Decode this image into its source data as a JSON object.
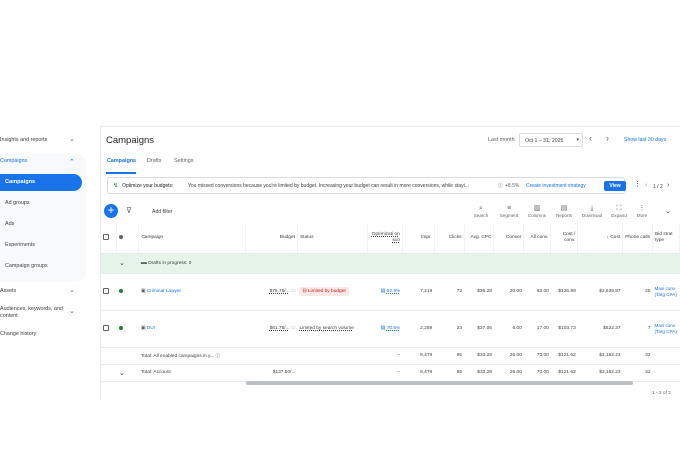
{
  "sidebar": {
    "items": [
      {
        "label": "Insights and reports",
        "chevron": "⌄"
      },
      {
        "label": "Campaigns",
        "chevron": "⌃"
      },
      {
        "label": "Campaigns"
      },
      {
        "label": "Ad groups"
      },
      {
        "label": "Ads"
      },
      {
        "label": "Experiments"
      },
      {
        "label": "Campaign groups"
      },
      {
        "label": "Assets",
        "chevron": "⌄"
      },
      {
        "label": "Audiences, keywords, and content",
        "chevron": "⌄"
      },
      {
        "label": "Change history"
      }
    ]
  },
  "header": {
    "title": "Campaigns",
    "date_label": "Last month",
    "date_range": "Oct 1 – 31, 2025",
    "show_last": "Show last 30 days"
  },
  "tabs": [
    "Campaigns",
    "Drafts",
    "Settings"
  ],
  "banner": {
    "bold": "Optimize your budgets:",
    "text": "You missed conversions because you're limited by budget. Increasing your budget can result in more conversions, while stayi...",
    "uplift": "+8.5%",
    "link": "Create investment strategy",
    "button": "View",
    "pager": "1 / 2"
  },
  "toolbar": {
    "add_filter": "Add filter",
    "buttons": [
      "Search",
      "Segment",
      "Columns",
      "Reports",
      "Download",
      "Expand",
      "More"
    ]
  },
  "table": {
    "headers": [
      "Campaign",
      "Budget",
      "Status",
      "Optimizati on sco",
      "Impr.",
      "Clicks",
      "Avg. CPC",
      "Conver",
      "All conv.",
      "Cost / conv.",
      "Cost",
      "Phone calls",
      "Bid strat type"
    ],
    "drafts_label": "Drafts in progress: 0",
    "rows": [
      {
        "name": "Criminal Lawyer",
        "budget": "$75.75/...",
        "status": "Limited by budget",
        "opt": "52.9%",
        "impr": "7,219",
        "clicks": "72",
        "cpc": "$35.28",
        "conv": "20.00",
        "allconv": "53.00",
        "costconv": "$126.99",
        "cost": "$2,539.87",
        "calls": "25",
        "bid": "Maxi conv (Targ CPA)"
      },
      {
        "name": "DUI",
        "budget": "$61.75/...",
        "status": "Limited by search volume",
        "opt": "70.5%",
        "impr": "2,259",
        "clicks": "23",
        "cpc": "$27.06",
        "conv": "6.00",
        "allconv": "17.00",
        "costconv": "$103.73",
        "cost": "$622.37",
        "calls": "7",
        "bid": "Maxi conv (Targ CPA)"
      }
    ],
    "totals": [
      {
        "label": "Total: All enabled campaigns in y...",
        "budget": "",
        "opt": "--",
        "impr": "9,478",
        "clicks": "95",
        "cpc": "$33.29",
        "conv": "26.00",
        "allconv": "70.00",
        "costconv": "$121.62",
        "cost": "$3,162.23",
        "calls": "32"
      },
      {
        "label": "Total: Account",
        "budget": "$137.50/...",
        "opt": "--",
        "impr": "9,478",
        "clicks": "95",
        "cpc": "$33.29",
        "conv": "26.00",
        "allconv": "70.00",
        "costconv": "$121.62",
        "cost": "$3,162.23",
        "calls": "32"
      }
    ],
    "pager": "1 - 2 of 2"
  },
  "colors": {
    "accent": "#1a73e8",
    "draft_bg": "#e6f4ea",
    "status_limited_bg": "#fce8e6",
    "status_limited_text": "#c5221f"
  }
}
